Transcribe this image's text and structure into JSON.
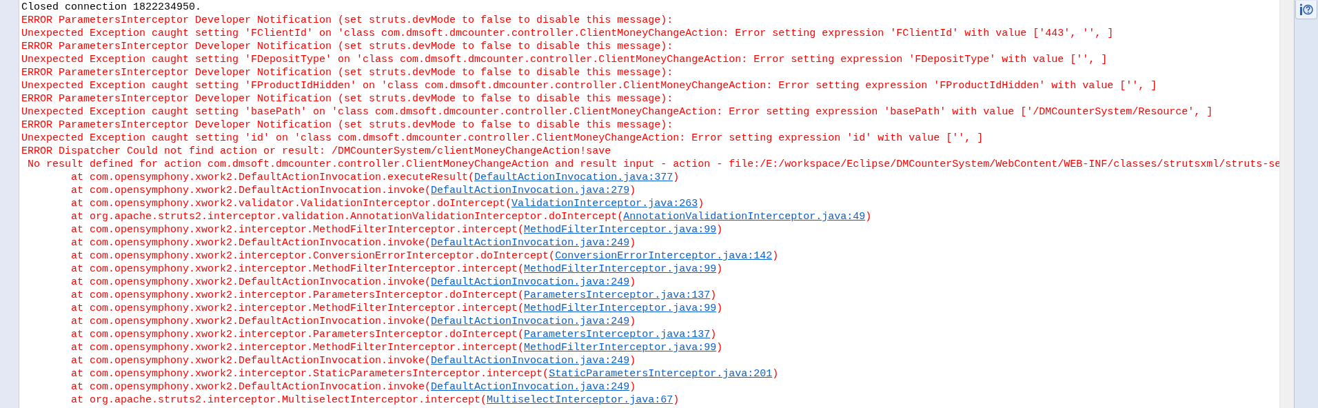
{
  "console": {
    "lines": [
      {
        "kind": "plain",
        "text": "Closed connection 1822234950."
      },
      {
        "kind": "error",
        "text": "ERROR ParametersInterceptor Developer Notification (set struts.devMode to false to disable this message):"
      },
      {
        "kind": "error",
        "text": "Unexpected Exception caught setting 'FClientId' on 'class com.dmsoft.dmcounter.controller.ClientMoneyChangeAction: Error setting expression 'FClientId' with value ['443', '', ]"
      },
      {
        "kind": "error",
        "text": "ERROR ParametersInterceptor Developer Notification (set struts.devMode to false to disable this message):"
      },
      {
        "kind": "error",
        "text": "Unexpected Exception caught setting 'FDepositType' on 'class com.dmsoft.dmcounter.controller.ClientMoneyChangeAction: Error setting expression 'FDepositType' with value ['', ]"
      },
      {
        "kind": "error",
        "text": "ERROR ParametersInterceptor Developer Notification (set struts.devMode to false to disable this message):"
      },
      {
        "kind": "error",
        "text": "Unexpected Exception caught setting 'FProductIdHidden' on 'class com.dmsoft.dmcounter.controller.ClientMoneyChangeAction: Error setting expression 'FProductIdHidden' with value ['', ]"
      },
      {
        "kind": "error",
        "text": "ERROR ParametersInterceptor Developer Notification (set struts.devMode to false to disable this message):"
      },
      {
        "kind": "error",
        "text": "Unexpected Exception caught setting 'basePath' on 'class com.dmsoft.dmcounter.controller.ClientMoneyChangeAction: Error setting expression 'basePath' with value ['/DMCounterSystem/Resource', ]"
      },
      {
        "kind": "error",
        "text": "ERROR ParametersInterceptor Developer Notification (set struts.devMode to false to disable this message):"
      },
      {
        "kind": "error",
        "text": "Unexpected Exception caught setting 'id' on 'class com.dmsoft.dmcounter.controller.ClientMoneyChangeAction: Error setting expression 'id' with value ['', ]"
      },
      {
        "kind": "error",
        "text": "ERROR Dispatcher Could not find action or result: /DMCounterSystem/clientMoneyChangeAction!save"
      },
      {
        "kind": "detail",
        "text": "No result defined for action com.dmsoft.dmcounter.controller.ClientMoneyChangeAction and result input - action - file:/E:/workspace/Eclipse/DMCounterSystem/WebContent/WEB-INF/classes/strutsxml/struts-se"
      },
      {
        "kind": "frame",
        "text": "at com.opensymphony.xwork2.DefaultActionInvocation.executeResult(",
        "link": "DefaultActionInvocation.java:377",
        "end": ")"
      },
      {
        "kind": "frame",
        "text": "at com.opensymphony.xwork2.DefaultActionInvocation.invoke(",
        "link": "DefaultActionInvocation.java:279",
        "end": ")"
      },
      {
        "kind": "frame",
        "text": "at com.opensymphony.xwork2.validator.ValidationInterceptor.doIntercept(",
        "link": "ValidationInterceptor.java:263",
        "end": ")"
      },
      {
        "kind": "frame",
        "text": "at org.apache.struts2.interceptor.validation.AnnotationValidationInterceptor.doIntercept(",
        "link": "AnnotationValidationInterceptor.java:49",
        "end": ")"
      },
      {
        "kind": "frame",
        "text": "at com.opensymphony.xwork2.interceptor.MethodFilterInterceptor.intercept(",
        "link": "MethodFilterInterceptor.java:99",
        "end": ")"
      },
      {
        "kind": "frame",
        "text": "at com.opensymphony.xwork2.DefaultActionInvocation.invoke(",
        "link": "DefaultActionInvocation.java:249",
        "end": ")"
      },
      {
        "kind": "frame",
        "text": "at com.opensymphony.xwork2.interceptor.ConversionErrorInterceptor.doIntercept(",
        "link": "ConversionErrorInterceptor.java:142",
        "end": ")"
      },
      {
        "kind": "frame",
        "text": "at com.opensymphony.xwork2.interceptor.MethodFilterInterceptor.intercept(",
        "link": "MethodFilterInterceptor.java:99",
        "end": ")"
      },
      {
        "kind": "frame",
        "text": "at com.opensymphony.xwork2.DefaultActionInvocation.invoke(",
        "link": "DefaultActionInvocation.java:249",
        "end": ")"
      },
      {
        "kind": "frame",
        "text": "at com.opensymphony.xwork2.interceptor.ParametersInterceptor.doIntercept(",
        "link": "ParametersInterceptor.java:137",
        "end": ")"
      },
      {
        "kind": "frame",
        "text": "at com.opensymphony.xwork2.interceptor.MethodFilterInterceptor.intercept(",
        "link": "MethodFilterInterceptor.java:99",
        "end": ")"
      },
      {
        "kind": "frame",
        "text": "at com.opensymphony.xwork2.DefaultActionInvocation.invoke(",
        "link": "DefaultActionInvocation.java:249",
        "end": ")"
      },
      {
        "kind": "frame",
        "text": "at com.opensymphony.xwork2.interceptor.ParametersInterceptor.doIntercept(",
        "link": "ParametersInterceptor.java:137",
        "end": ")"
      },
      {
        "kind": "frame",
        "text": "at com.opensymphony.xwork2.interceptor.MethodFilterInterceptor.intercept(",
        "link": "MethodFilterInterceptor.java:99",
        "end": ")"
      },
      {
        "kind": "frame",
        "text": "at com.opensymphony.xwork2.DefaultActionInvocation.invoke(",
        "link": "DefaultActionInvocation.java:249",
        "end": ")"
      },
      {
        "kind": "frame",
        "text": "at com.opensymphony.xwork2.interceptor.StaticParametersInterceptor.intercept(",
        "link": "StaticParametersInterceptor.java:201",
        "end": ")"
      },
      {
        "kind": "frame",
        "text": "at com.opensymphony.xwork2.DefaultActionInvocation.invoke(",
        "link": "DefaultActionInvocation.java:249",
        "end": ")"
      },
      {
        "kind": "frame",
        "text": "at org.apache.struts2.interceptor.MultiselectInterceptor.intercept(",
        "link": "MultiselectInterceptor.java:67",
        "end": ")"
      }
    ]
  }
}
